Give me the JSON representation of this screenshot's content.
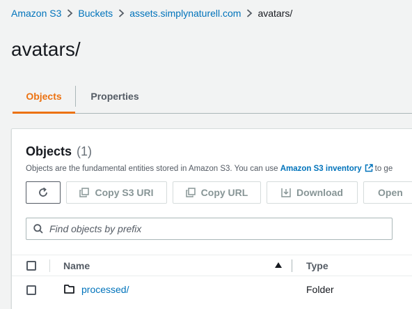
{
  "breadcrumb": {
    "items": [
      {
        "label": "Amazon S3"
      },
      {
        "label": "Buckets"
      },
      {
        "label": "assets.simplynaturell.com"
      }
    ],
    "current": "avatars/"
  },
  "page": {
    "title": "avatars/"
  },
  "tabs": [
    {
      "label": "Objects",
      "active": true
    },
    {
      "label": "Properties",
      "active": false
    }
  ],
  "objects": {
    "header_title": "Objects",
    "count_text": "(1)",
    "description_prefix": "Objects are the fundamental entities stored in Amazon S3. You can use ",
    "description_link": "Amazon S3 inventory",
    "description_suffix": "to ge",
    "actions": {
      "refresh_icon": "refresh-icon",
      "copy_uri": "Copy S3 URI",
      "copy_url": "Copy URL",
      "download": "Download",
      "open": "Open"
    },
    "search": {
      "placeholder": "Find objects by prefix",
      "value": ""
    },
    "table": {
      "columns": [
        "Name",
        "Type"
      ],
      "sort": {
        "column": "Name",
        "direction": "ascending"
      },
      "rows": [
        {
          "name": "processed/",
          "type": "Folder",
          "icon": "folder-icon"
        }
      ]
    }
  },
  "colors": {
    "link": "#0073bb",
    "active_tab": "#ec7211",
    "disabled_text": "#879596",
    "background": "#f2f3f3"
  }
}
